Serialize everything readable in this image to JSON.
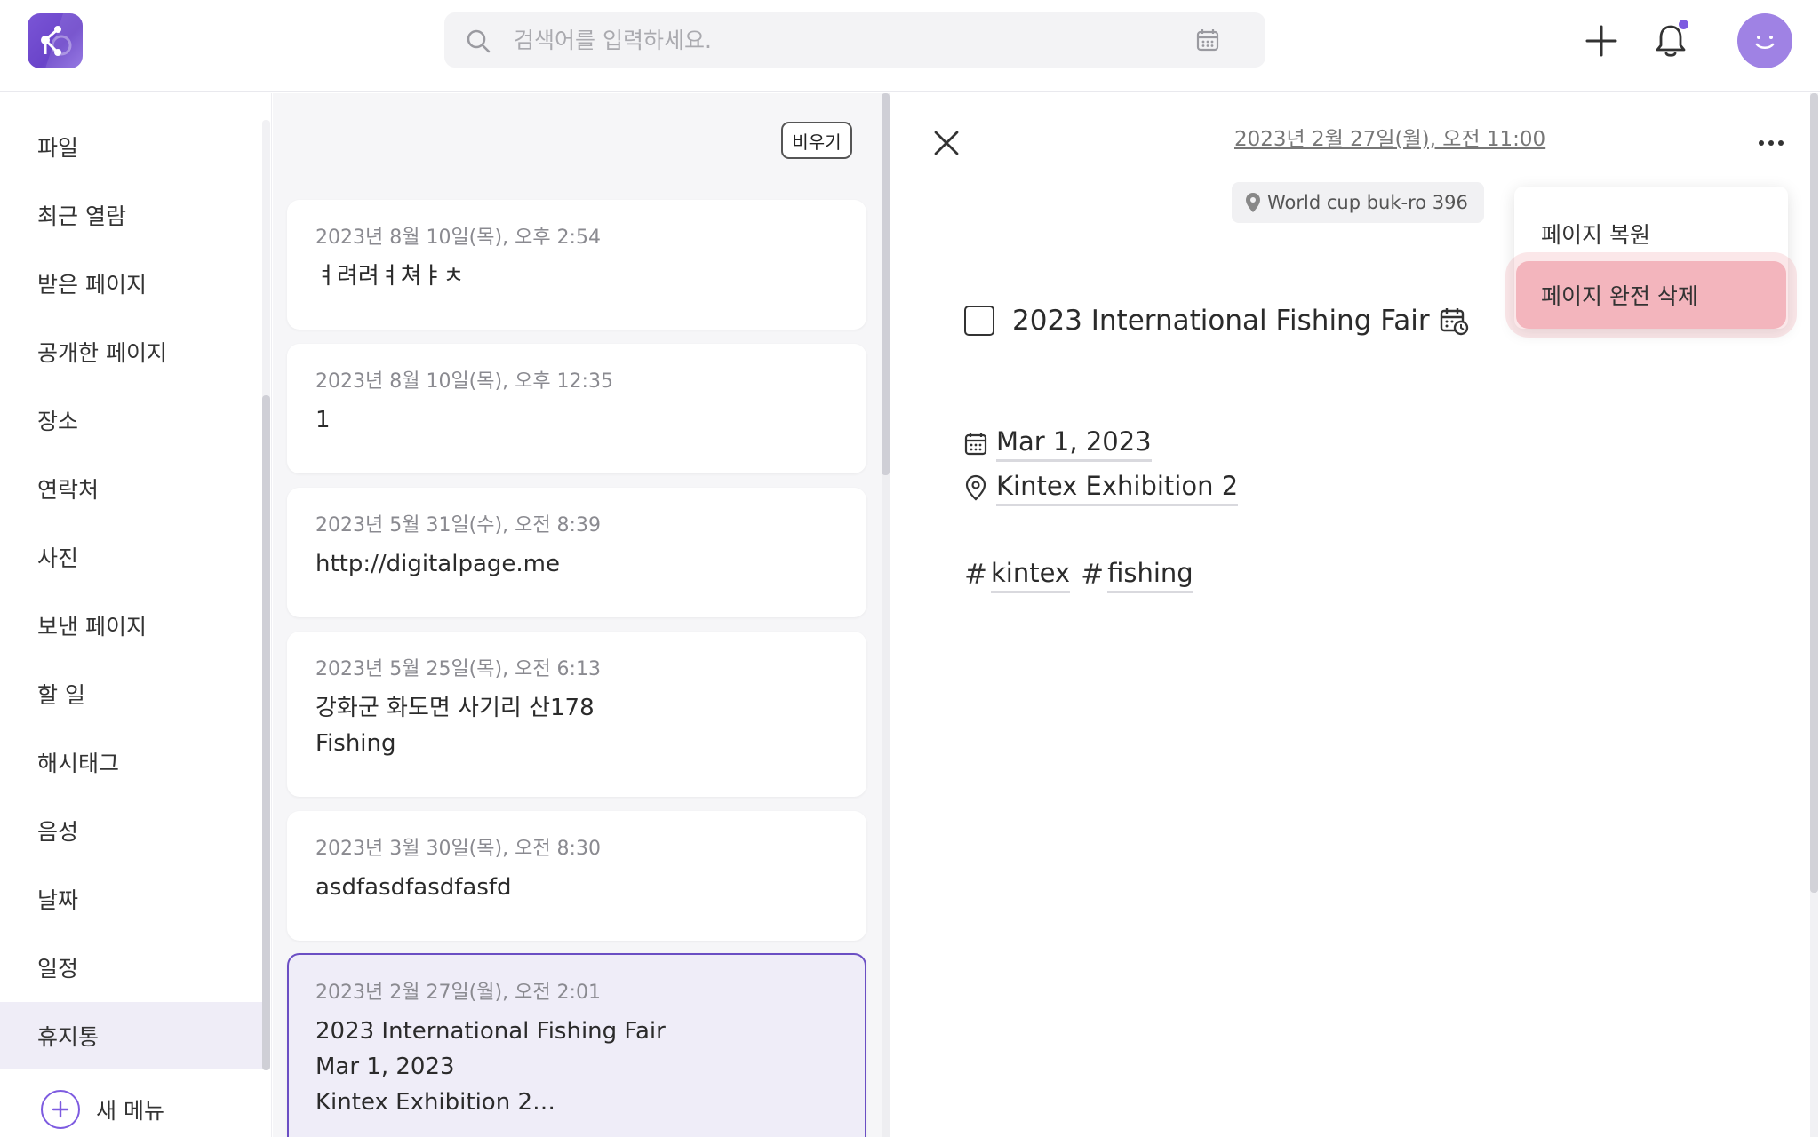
{
  "header": {
    "search_placeholder": "검색어를 입력하세요."
  },
  "sidebar": {
    "items": [
      {
        "label": "파일"
      },
      {
        "label": "최근 열람"
      },
      {
        "label": "받은 페이지"
      },
      {
        "label": "공개한 페이지"
      },
      {
        "label": "장소"
      },
      {
        "label": "연락처"
      },
      {
        "label": "사진"
      },
      {
        "label": "보낸 페이지"
      },
      {
        "label": "할 일"
      },
      {
        "label": "해시태그"
      },
      {
        "label": "음성"
      },
      {
        "label": "날짜"
      },
      {
        "label": "일정"
      },
      {
        "label": "휴지통",
        "active": true
      }
    ],
    "new_menu_label": "새 메뉴"
  },
  "trash_list": {
    "empty_button_label": "비우기",
    "cards": [
      {
        "date": "2023년 8월 10일(목), 오후 2:54",
        "lines": [
          "ㅕ려려ㅕ쳐ㅑㅊ"
        ]
      },
      {
        "date": "2023년 8월 10일(목), 오후 12:35",
        "lines": [
          "1"
        ]
      },
      {
        "date": "2023년 5월 31일(수), 오전 8:39",
        "lines": [
          "http://digitalpage.me"
        ]
      },
      {
        "date": "2023년 5월 25일(목), 오전 6:13",
        "lines": [
          "강화군 화도면 사기리 산178",
          "Fishing"
        ]
      },
      {
        "date": "2023년 3월 30일(목), 오전 8:30",
        "lines": [
          "asdfasdfasdfasfd"
        ]
      },
      {
        "date": "2023년 2월 27일(월), 오전 2:01",
        "lines": [
          "2023 International Fishing Fair",
          "Mar 1, 2023",
          "Kintex Exhibition 2…"
        ],
        "selected": true
      }
    ]
  },
  "detail": {
    "date": "2023년 2월 27일(월), 오전 11:00",
    "location_chip": "World cup buk-ro 396",
    "task_title": "2023 International Fishing Fair",
    "event_date": "Mar 1, 2023",
    "event_location": "Kintex Exhibition 2",
    "tags": [
      "kintex",
      "fishing"
    ]
  },
  "context_menu": {
    "restore_label": "페이지 복원",
    "delete_label": "페이지 완전 삭제"
  },
  "colors": {
    "accent": "#7d5be0",
    "selected_border": "#6b4fc4",
    "delete_highlight": "#e87887"
  }
}
